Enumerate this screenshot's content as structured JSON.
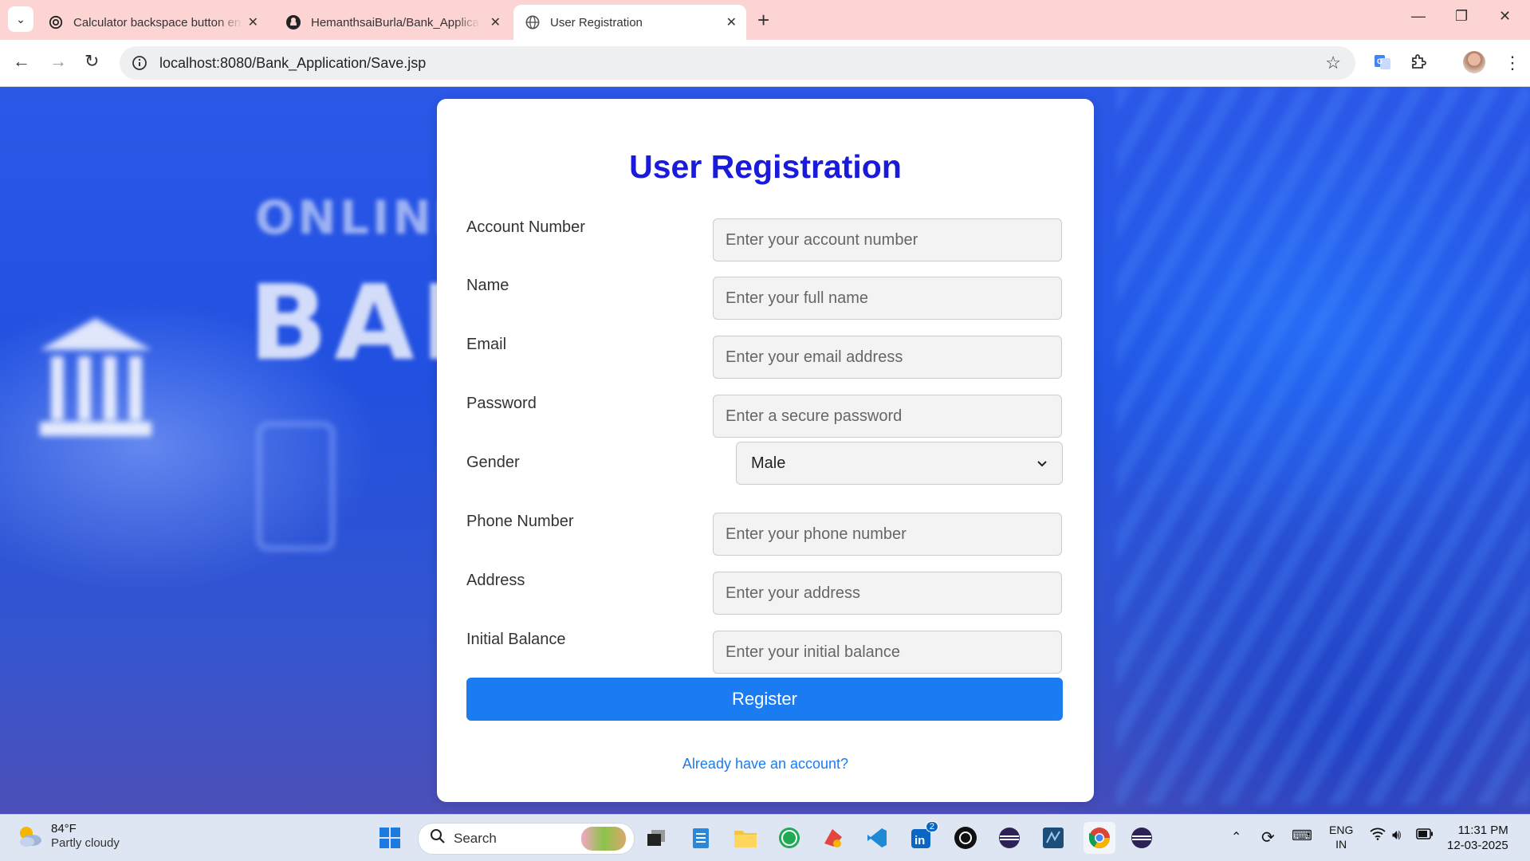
{
  "browser": {
    "tabs": [
      {
        "title": "Calculator backspace button en",
        "close": "✕",
        "icon": "openai-icon",
        "active": false
      },
      {
        "title": "HemanthsaiBurla/Bank_Applicat",
        "close": "✕",
        "icon": "github-icon",
        "active": false
      },
      {
        "title": "User Registration",
        "close": "✕",
        "icon": "globe-icon",
        "active": true
      }
    ],
    "new_tab": "+",
    "url": "localhost:8080/Bank_Application/Save.jsp"
  },
  "background": {
    "text_online": "ONLINE",
    "text_bank": "BANK"
  },
  "form": {
    "title": "User Registration",
    "fields": [
      {
        "label": "Account Number",
        "placeholder": "Enter your account number"
      },
      {
        "label": "Name",
        "placeholder": "Enter your full name"
      },
      {
        "label": "Email",
        "placeholder": "Enter your email address"
      },
      {
        "label": "Password",
        "placeholder": "Enter a secure password"
      },
      {
        "label": "Gender",
        "value": "Male"
      },
      {
        "label": "Phone Number",
        "placeholder": "Enter your phone number"
      },
      {
        "label": "Address",
        "placeholder": "Enter your address"
      },
      {
        "label": "Initial Balance",
        "placeholder": "Enter your initial balance"
      }
    ],
    "register_label": "Register",
    "login_link": "Already have an account?",
    "colors": {
      "title": "#1a1adb",
      "button": "#1a7cf0",
      "link": "#1a7cf0"
    }
  },
  "taskbar": {
    "weather_temp": "84°F",
    "weather_condition": "Partly cloudy",
    "search_placeholder": "Search",
    "linkedin_badge": "2",
    "language_line1": "ENG",
    "language_line2": "IN",
    "time": "11:31 PM",
    "date": "12-03-2025"
  }
}
